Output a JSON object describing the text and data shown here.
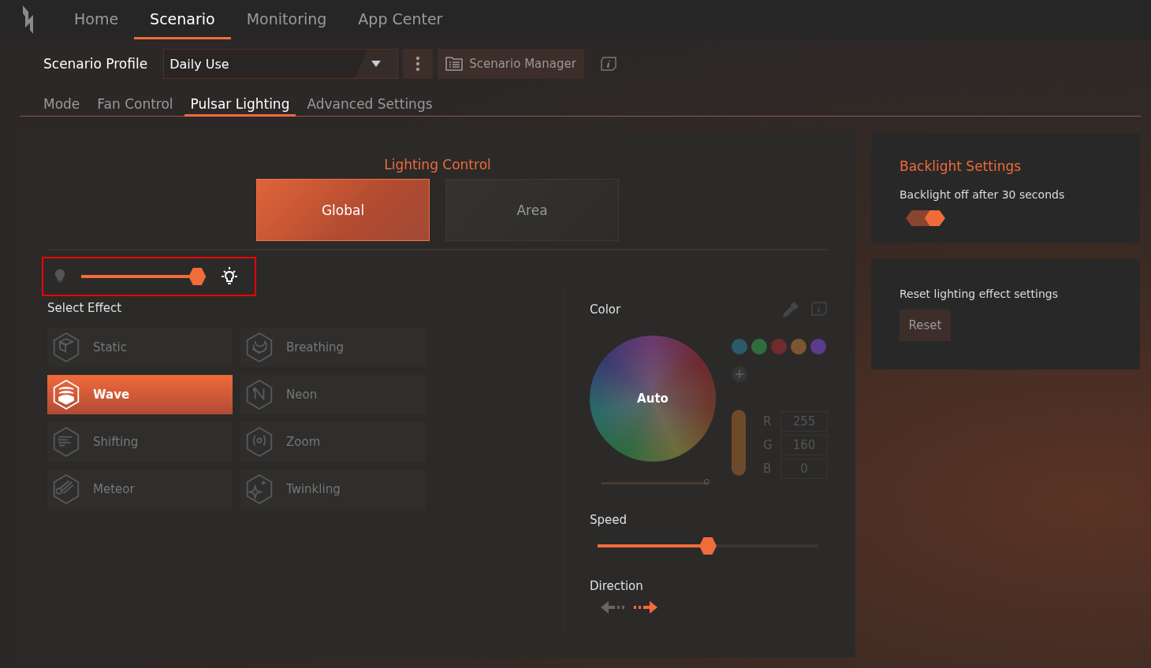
{
  "nav_tabs": [
    {
      "label": "Home",
      "selected": false
    },
    {
      "label": "Scenario",
      "selected": true
    },
    {
      "label": "Monitoring",
      "selected": false
    },
    {
      "label": "App Center",
      "selected": false
    }
  ],
  "profile": {
    "label": "Scenario Profile",
    "value": "Daily Use",
    "manager_button": "Scenario Manager"
  },
  "sub_tabs": [
    {
      "label": "Mode",
      "selected": false
    },
    {
      "label": "Fan Control",
      "selected": false
    },
    {
      "label": "Pulsar Lighting",
      "selected": true
    },
    {
      "label": "Advanced Settings",
      "selected": false
    }
  ],
  "lighting": {
    "title": "Lighting Control",
    "modes": [
      {
        "label": "Global",
        "selected": true
      },
      {
        "label": "Area",
        "selected": false
      }
    ],
    "brightness": {
      "level": 0.95
    },
    "effect_title": "Select Effect",
    "effects": [
      {
        "label": "Static",
        "selected": false
      },
      {
        "label": "Breathing",
        "selected": false
      },
      {
        "label": "Wave",
        "selected": true
      },
      {
        "label": "Neon",
        "selected": false
      },
      {
        "label": "Shifting",
        "selected": false
      },
      {
        "label": "Zoom",
        "selected": false
      },
      {
        "label": "Meteor",
        "selected": false
      },
      {
        "label": "Twinkling",
        "selected": false
      }
    ],
    "color": {
      "title": "Color",
      "wheel_label": "Auto",
      "swatches": [
        {
          "color": "#2c5a66"
        },
        {
          "color": "#2f6c3e"
        },
        {
          "color": "#702b2d"
        },
        {
          "color": "#7c5633"
        },
        {
          "color": "#5b3b8c"
        }
      ],
      "wheel_slider": {
        "level": 1
      },
      "value_slider": {
        "level": 1
      },
      "rgb": [
        {
          "label": "R",
          "value": "255",
          "disabled": true
        },
        {
          "label": "G",
          "value": "160",
          "disabled": true
        },
        {
          "label": "B",
          "value": "0",
          "disabled": true
        }
      ]
    },
    "speed": {
      "label": "Speed",
      "level": 0.5
    },
    "direction": {
      "label": "Direction",
      "options": [
        {
          "selected": false
        },
        {
          "selected": true
        }
      ]
    }
  },
  "backlight": {
    "title": "Backlight Settings",
    "text": "Backlight off after 30 seconds",
    "on": true
  },
  "reset": {
    "text": "Reset lighting effect settings",
    "button": "Reset"
  }
}
